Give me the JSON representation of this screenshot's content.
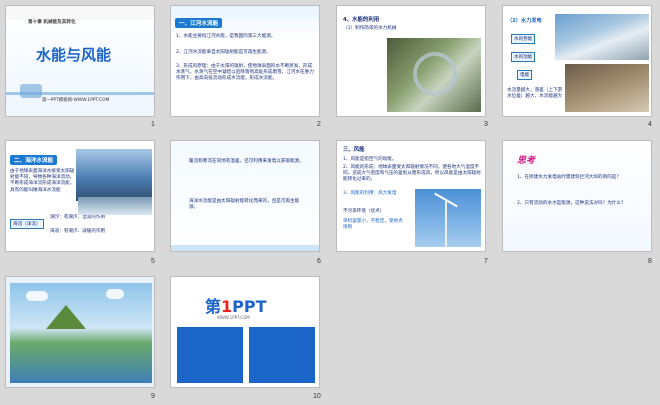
{
  "slides": [
    {
      "num": "1",
      "chapter": "第十章 机械能及其转化",
      "title": "水能与风能",
      "footer": "第一PPT模板网-WWW.1PPT.COM"
    },
    {
      "num": "2",
      "header": "一、江河水流能",
      "p1": "1、水能主要指江河水能，是我国的第三大能源。",
      "p2": "2、江河水流能来自太阳辐射能是可再生能源。",
      "p3": "3、形成的原理：由于太阳的辐射，使地球表面的水不断蒸发，形成水蒸气，水蒸气在空中凝结以后降落到高处形成雨雪，江河水在重力作用下，由高向低流动形成水流能，形成水流能。"
    },
    {
      "num": "3",
      "header": "4、水能的利用",
      "sub": "（1）制作简单的水力机械"
    },
    {
      "num": "4",
      "header": "（2）水力发电",
      "l1": "水的势能",
      "l2": "水的动能",
      "l3": "电能",
      "caption": "水流量越大，落差（上下游水位差）越大，水流能越大"
    },
    {
      "num": "5",
      "header": "二、海洋水流能",
      "body": "由于地球表面海洋水接受太阳辐射能不同，导致各种海洋流动，不断形成海洋流形成海洋流能，具有的能叫做海洋水流能",
      "tag1": "海流（洋流）",
      "l1": "潮汐：有潮汐、湿润的作用",
      "l2": "海浪：有潮汐、减缓的作用"
    },
    {
      "num": "6",
      "p1": "暖流和寒流在同地有温差，还可利用来发电以获取能源。",
      "p2": "海洋水流能是由太阳辐射能转化而来的，且是可再生能源。"
    },
    {
      "num": "7",
      "header": "三、风能",
      "p1": "1、风能是指空气的动能。",
      "p2": "2、风能的形成：地球表面受太阳辐射情况不同，使各地大气温度不同，造成大气密度和气压的差别从而形成风，所以风能是由太阳辐射能转化过来的。",
      "p3": "3、风能的利用：风力发电",
      "p4": "不污染环境（优点）",
      "p5": "单机容量小，不稳定，受地点限制"
    },
    {
      "num": "8",
      "header": "思考",
      "q1": "1、在修建水力发电站时需建筑拦河大坝的目的是？",
      "q2": "2、只有流动的水才是能源，这种说法对吗？为什么？"
    },
    {
      "num": "9"
    },
    {
      "num": "10",
      "logo1": "第",
      "logo2": "1",
      "logo3": "PPT",
      "sub": "WWW.1PPT.COM"
    }
  ]
}
